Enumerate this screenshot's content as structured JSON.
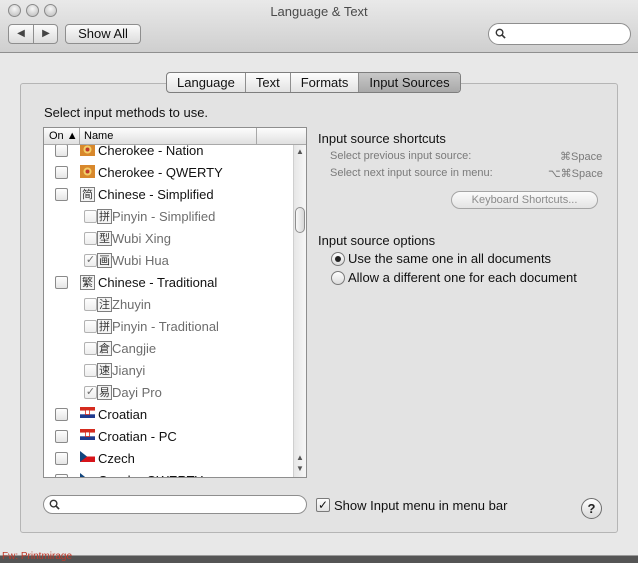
{
  "window": {
    "title": "Language & Text",
    "nav": {
      "back_glyph": "◀",
      "forward_glyph": "▶"
    },
    "show_all_label": "Show All"
  },
  "tabs": [
    {
      "label": "Language",
      "active": false
    },
    {
      "label": "Text",
      "active": false
    },
    {
      "label": "Formats",
      "active": false
    },
    {
      "label": "Input Sources",
      "active": true
    }
  ],
  "input_methods": {
    "heading": "Select input methods to use.",
    "columns": {
      "on": "On ▲",
      "name": "Name"
    },
    "rows": [
      {
        "name": "Cherokee - Nation",
        "checked": false,
        "sub": false,
        "icon": "flag-icon"
      },
      {
        "name": "Cherokee - QWERTY",
        "checked": false,
        "sub": false,
        "icon": "flag-icon"
      },
      {
        "name": "Chinese - Simplified",
        "checked": false,
        "sub": false,
        "icon": "简"
      },
      {
        "name": "Pinyin - Simplified",
        "checked": false,
        "sub": true,
        "icon": "拼"
      },
      {
        "name": "Wubi Xing",
        "checked": false,
        "sub": true,
        "icon": "型"
      },
      {
        "name": "Wubi Hua",
        "checked": true,
        "sub": true,
        "icon": "画"
      },
      {
        "name": "Chinese - Traditional",
        "checked": false,
        "sub": false,
        "icon": "繁"
      },
      {
        "name": "Zhuyin",
        "checked": false,
        "sub": true,
        "icon": "注"
      },
      {
        "name": "Pinyin - Traditional",
        "checked": false,
        "sub": true,
        "icon": "拼"
      },
      {
        "name": "Cangjie",
        "checked": false,
        "sub": true,
        "icon": "倉"
      },
      {
        "name": "Jianyi",
        "checked": false,
        "sub": true,
        "icon": "速"
      },
      {
        "name": "Dayi Pro",
        "checked": true,
        "sub": true,
        "icon": "易"
      },
      {
        "name": "Croatian",
        "checked": false,
        "sub": false,
        "icon": "croatia-flag-icon"
      },
      {
        "name": "Croatian - PC",
        "checked": false,
        "sub": false,
        "icon": "croatia-flag-icon"
      },
      {
        "name": "Czech",
        "checked": false,
        "sub": false,
        "icon": "czech-flag-icon"
      },
      {
        "name": "Czech - QWERTY",
        "checked": false,
        "sub": false,
        "icon": "czech-flag-icon"
      }
    ],
    "search_placeholder": ""
  },
  "shortcuts": {
    "heading": "Input source shortcuts",
    "previous": {
      "label": "Select previous input source:",
      "key": "⌘Space"
    },
    "next": {
      "label": "Select next input source in menu:",
      "key": "⌥⌘Space"
    },
    "button_label": "Keyboard Shortcuts..."
  },
  "options": {
    "heading": "Input source options",
    "same_label": "Use the same one in all documents",
    "different_label": "Allow a different one for each document",
    "selected": "same"
  },
  "show_menu": {
    "label": "Show Input menu in menu bar",
    "checked": true
  },
  "help_label": "?",
  "behind_text": "Fw: Printmirage"
}
